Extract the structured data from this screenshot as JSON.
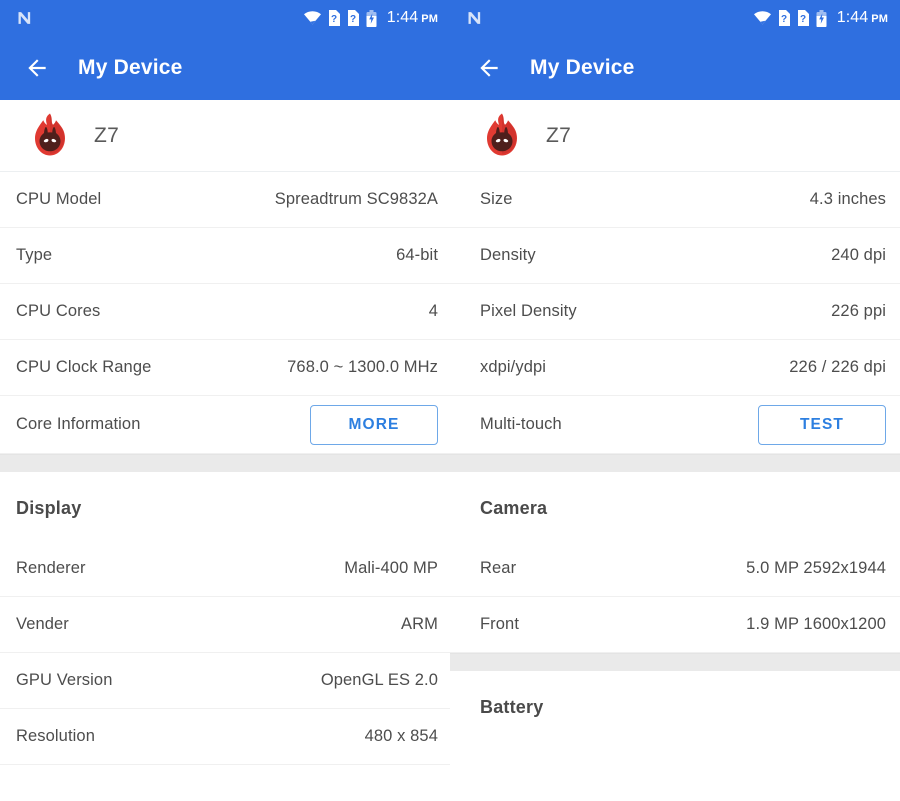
{
  "theme": {
    "accent_blue": "#2f6fe0",
    "link_blue": "#2d7fe0",
    "band_gray": "#eaeaea",
    "text_gray": "#4d4d4d",
    "logo_red": "#e03a32",
    "logo_dark": "#5c2320"
  },
  "status_bar": {
    "time": "1:44",
    "ampm": "PM",
    "icons": [
      "android-n-logo-icon",
      "wifi-icon",
      "sim-unknown-icon",
      "sim-unknown-icon",
      "battery-charging-icon"
    ]
  },
  "app_bar": {
    "back_label": "back-arrow-icon",
    "title": "My Device"
  },
  "device_header": {
    "logo": "antutu-logo-icon",
    "name": "Z7"
  },
  "left_panel": {
    "cpu_rows": [
      {
        "label": "CPU Model",
        "value": "Spreadtrum SC9832A",
        "type": "text"
      },
      {
        "label": "Type",
        "value": "64-bit",
        "type": "text"
      },
      {
        "label": "CPU Cores",
        "value": "4",
        "type": "text"
      },
      {
        "label": "CPU Clock Range",
        "value": "768.0 ~ 1300.0 MHz",
        "type": "text"
      },
      {
        "label": "Core Information",
        "value": "MORE",
        "type": "button"
      }
    ],
    "display_section": {
      "heading": "Display",
      "rows": [
        {
          "label": "Renderer",
          "value": "Mali-400 MP",
          "type": "text"
        },
        {
          "label": "Vender",
          "value": "ARM",
          "type": "text"
        },
        {
          "label": "GPU Version",
          "value": "OpenGL ES 2.0",
          "type": "text"
        },
        {
          "label": "Resolution",
          "value": "480 x 854",
          "type": "text"
        }
      ]
    }
  },
  "right_panel": {
    "screen_rows": [
      {
        "label": "Size",
        "value": "4.3 inches",
        "type": "text"
      },
      {
        "label": "Density",
        "value": "240 dpi",
        "type": "text"
      },
      {
        "label": "Pixel Density",
        "value": "226 ppi",
        "type": "text"
      },
      {
        "label": "xdpi/ydpi",
        "value": "226 / 226 dpi",
        "type": "text"
      },
      {
        "label": "Multi-touch",
        "value": "TEST",
        "type": "button"
      }
    ],
    "camera_section": {
      "heading": "Camera",
      "rows": [
        {
          "label": "Rear",
          "value": "5.0 MP 2592x1944",
          "type": "text"
        },
        {
          "label": "Front",
          "value": "1.9 MP 1600x1200",
          "type": "text"
        }
      ]
    },
    "battery_section": {
      "heading": "Battery"
    }
  }
}
